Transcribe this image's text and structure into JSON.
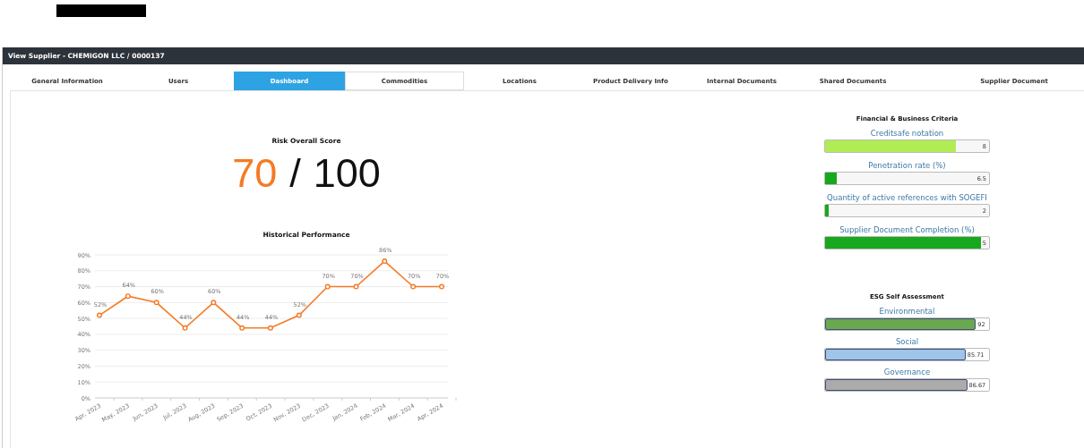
{
  "window": {
    "title": "View Supplier - CHEMIGON LLC / 0000137"
  },
  "tabs": [
    {
      "label": "General Information",
      "selected": false
    },
    {
      "label": "Users",
      "selected": false
    },
    {
      "label": "Dashboard",
      "selected": true
    },
    {
      "label": "Commodities",
      "selected": false
    },
    {
      "label": "Locations",
      "selected": false
    },
    {
      "label": "Product Delivery Info",
      "selected": false
    },
    {
      "label": "Internal Documents",
      "selected": false
    },
    {
      "label": "Shared Documents",
      "selected": false
    },
    {
      "label": "Supplier Document",
      "selected": false
    }
  ],
  "risk": {
    "title": "Risk Overall Score",
    "score": "70",
    "separator": "/",
    "max": "100"
  },
  "history": {
    "title": "Historical Performance",
    "chart_data": {
      "type": "line",
      "categories": [
        "Apr, 2023",
        "May, 2023",
        "Jun, 2023",
        "Jul, 2023",
        "Aug, 2023",
        "Sep, 2023",
        "Oct, 2023",
        "Nov, 2023",
        "Dec, 2023",
        "Jan, 2024",
        "Feb, 2024",
        "Mar, 2024",
        "Apr, 2024"
      ],
      "series": [
        {
          "color": "#f47b26",
          "marker": "circle",
          "values": [
            52,
            64,
            60,
            44,
            60,
            44,
            44,
            52,
            70,
            70,
            86,
            70,
            70
          ],
          "value_labels": [
            "52%",
            "64%",
            "60%",
            "44%",
            "60%",
            "44%",
            "44%",
            "52%",
            "70%",
            "70%",
            "86%",
            "70%",
            "70%"
          ]
        }
      ],
      "grid": true,
      "ylim": [
        0,
        90
      ],
      "yticks": [
        {
          "value": 0,
          "label": "0%"
        },
        {
          "value": 10,
          "label": "10%"
        },
        {
          "value": 20,
          "label": "20%"
        },
        {
          "value": 30,
          "label": "30%"
        },
        {
          "value": 40,
          "label": "40%"
        },
        {
          "value": 50,
          "label": "50%"
        },
        {
          "value": 60,
          "label": "60%"
        },
        {
          "value": 70,
          "label": "70%"
        },
        {
          "value": 80,
          "label": "80%"
        },
        {
          "value": 90,
          "label": "90%"
        }
      ],
      "data_labels": true
    }
  },
  "financial": {
    "title": "Financial & Business Criteria",
    "metrics": [
      {
        "label": "Creditsafe notation",
        "value": "8",
        "level": 0.8,
        "color": "#b2ec55"
      },
      {
        "label": "Penetration rate (%)",
        "value": "6.5",
        "level": 0.07,
        "color": "#17a81d"
      },
      {
        "label": "Quantity of active references with SOGEFI",
        "value": "2",
        "level": 0.02,
        "color": "#17a81d"
      },
      {
        "label": "Supplier Document Completion (%)",
        "value": "5",
        "level": 0.95,
        "color": "#17a81d"
      }
    ]
  },
  "esg": {
    "title": "ESG Self Assessment",
    "metrics": [
      {
        "label": "Environmental",
        "value": "92",
        "level": 0.92,
        "color": "#6aa84f"
      },
      {
        "label": "Social",
        "value": "85.71",
        "level": 0.8571,
        "color": "#9fc5e8"
      },
      {
        "label": "Governance",
        "value": "86.67",
        "level": 0.8667,
        "color": "#ababab"
      }
    ]
  }
}
